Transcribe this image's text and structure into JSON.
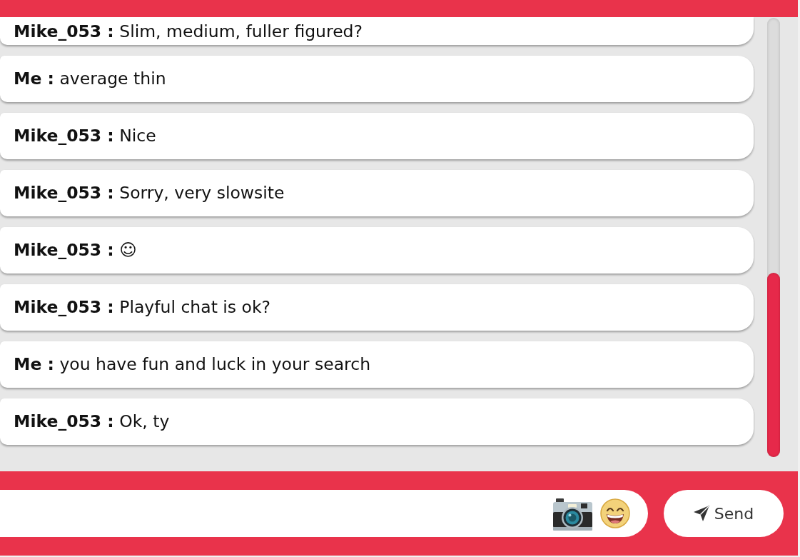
{
  "messages": [
    {
      "text": "**Mike_053 :** Slim, medium, fuller figured?"
    },
    {
      "text": "**Me :** average thin"
    },
    {
      "text": "**Mike_053 :** Nice"
    },
    {
      "text": "**Mike_053 :** Sorry, very slowsite"
    },
    {
      "text": "**Mike_053 :** ☺"
    },
    {
      "text": "**Mike_053 :** Playful chat is ok?"
    },
    {
      "text": "**Me :** you have fun and luck in your search"
    },
    {
      "text": "**Mike_053 :** Ok, ty"
    }
  ],
  "composer": {
    "send_label": "Send"
  }
}
